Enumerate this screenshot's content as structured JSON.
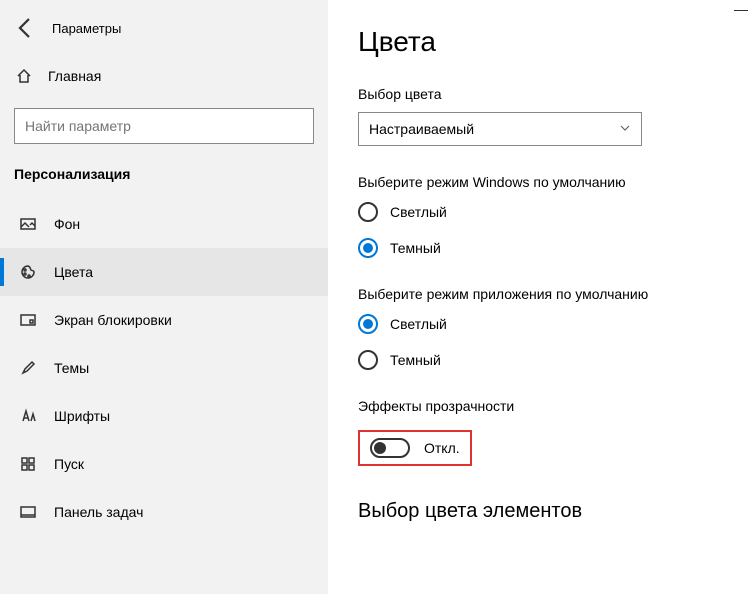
{
  "app_title": "Параметры",
  "home_label": "Главная",
  "search_placeholder": "Найти параметр",
  "section_label": "Персонализация",
  "nav": [
    {
      "label": "Фон"
    },
    {
      "label": "Цвета"
    },
    {
      "label": "Экран блокировки"
    },
    {
      "label": "Темы"
    },
    {
      "label": "Шрифты"
    },
    {
      "label": "Пуск"
    },
    {
      "label": "Панель задач"
    }
  ],
  "main": {
    "title": "Цвета",
    "color_choice_label": "Выбор цвета",
    "color_choice_value": "Настраиваемый",
    "win_mode_label": "Выберите режим Windows по умолчанию",
    "win_mode_light": "Светлый",
    "win_mode_dark": "Темный",
    "app_mode_label": "Выберите режим приложения по умолчанию",
    "app_mode_light": "Светлый",
    "app_mode_dark": "Темный",
    "transparency_label": "Эффекты прозрачности",
    "transparency_state": "Откл.",
    "accent_section_title": "Выбор цвета элементов"
  }
}
